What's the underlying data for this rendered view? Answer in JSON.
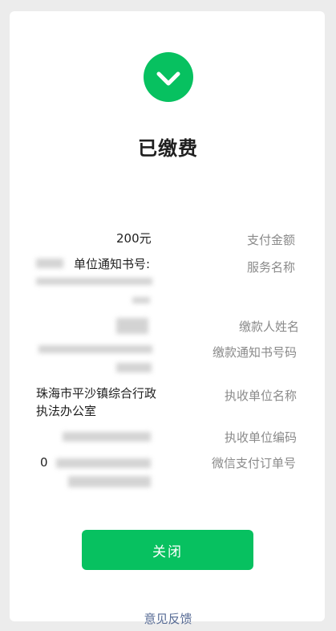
{
  "status": {
    "title": "已缴费",
    "icon": "check-circle-icon",
    "accent": "#07c160"
  },
  "details": {
    "rows": [
      {
        "label": "支付金额",
        "value": "200元"
      },
      {
        "label": "服务名称",
        "value": "单位通知书号:"
      },
      {
        "label": "缴款人姓名",
        "value": ""
      },
      {
        "label": "缴款通知书号码",
        "value": ""
      },
      {
        "label": "执收单位名称",
        "value": "珠海市平沙镇综合行政执法办公室"
      },
      {
        "label": "执收单位编码",
        "value": ""
      },
      {
        "label": "微信支付订单号",
        "value": "0"
      }
    ]
  },
  "actions": {
    "close_label": "关闭",
    "feedback_label": "意见反馈"
  }
}
